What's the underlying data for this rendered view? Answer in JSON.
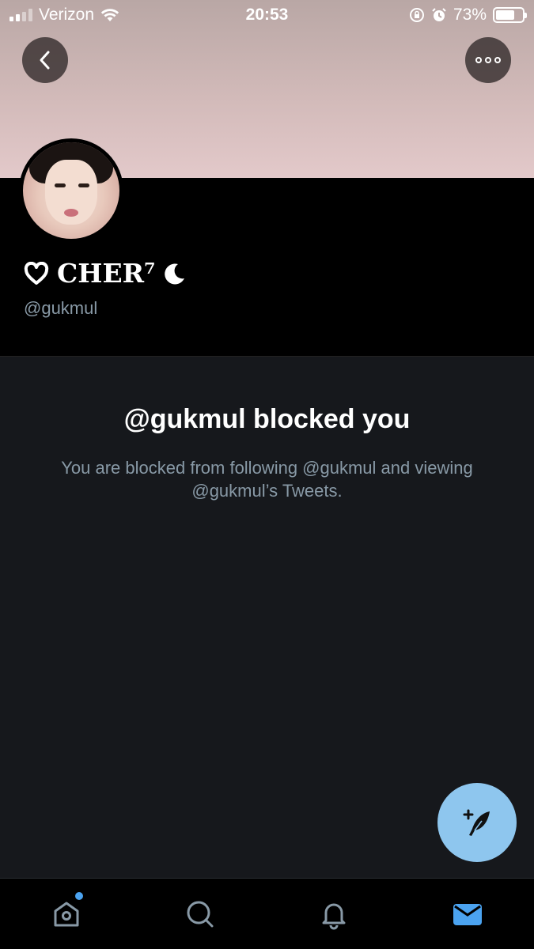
{
  "status_bar": {
    "carrier": "Verizon",
    "time": "20:53",
    "battery_percent": "73%",
    "battery_level": 0.73
  },
  "profile": {
    "display_name": "CHER⁷",
    "handle": "@gukmul"
  },
  "blocked": {
    "title": "@gukmul blocked you",
    "description": "You are blocked from following @gukmul and viewing @gukmul’s Tweets."
  },
  "tabs": [
    {
      "icon": "home-icon",
      "active": false,
      "has_badge": true
    },
    {
      "icon": "search-icon",
      "active": false
    },
    {
      "icon": "bell-icon",
      "active": false
    },
    {
      "icon": "mail-icon",
      "active": true
    }
  ],
  "colors": {
    "accent": "#4ba3f0",
    "fab": "#8ec6ee",
    "muted_text": "#8899a6",
    "main_bg": "#16181c"
  }
}
